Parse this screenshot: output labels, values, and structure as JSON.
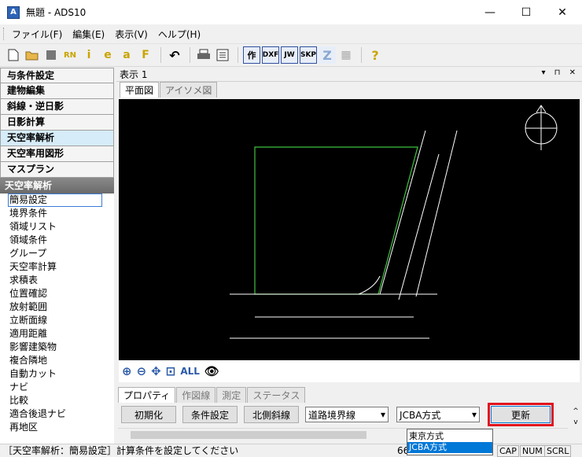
{
  "window": {
    "title": "無題 - ADS10",
    "minimize": "—",
    "maximize": "☐",
    "close": "✕"
  },
  "menu": [
    "ファイル(F)",
    "編集(E)",
    "表示(V)",
    "ヘルプ(H)"
  ],
  "toolbar": {
    "icons": [
      "new-icon",
      "open-icon",
      "stop-icon",
      "rn-icon",
      "info-icon",
      "e-icon",
      "a-icon",
      "f-icon",
      "undo-icon",
      "print-icon",
      "settings-icon"
    ],
    "tools": [
      "作",
      "DXF",
      "JW",
      "SKP"
    ],
    "z_label": "Z",
    "help": "?"
  },
  "left": {
    "categories": [
      "与条件設定",
      "建物編集",
      "斜線・逆日影",
      "日影計算",
      "天空率解析",
      "天空率用図形",
      "マスプラン"
    ],
    "active_category": "天空率解析",
    "section_header": "天空率解析",
    "items": [
      "簡易設定",
      "境界条件",
      "領域リスト",
      "領域条件",
      "グループ",
      "天空率計算",
      "求積表",
      "位置確認",
      "放射範囲",
      "立断面線",
      "適用距離",
      "影響建築物",
      "複合隣地",
      "自動カット",
      "ナビ",
      "比較",
      "適合後退ナビ",
      "再地区"
    ],
    "selected_item": "簡易設定"
  },
  "view": {
    "title": "表示 1",
    "tabs": [
      "平面図",
      "アイソメ図"
    ],
    "zoom_all": "ALL"
  },
  "bottom": {
    "tabs": [
      "プロパティ",
      "作図線",
      "測定",
      "ステータス"
    ],
    "buttons": [
      "初期化",
      "条件設定",
      "北側斜線"
    ],
    "select_road": "道路境界線",
    "select_method": "JCBA方式",
    "update": "更新",
    "dropdown_options": [
      "東京方式",
      "JCBA方式"
    ]
  },
  "status": {
    "text": "［天空率解析：簡易設定］計算条件を設定してください",
    "coord": "66.",
    "indicators": [
      "CAP",
      "NUM",
      "SCRL"
    ]
  }
}
